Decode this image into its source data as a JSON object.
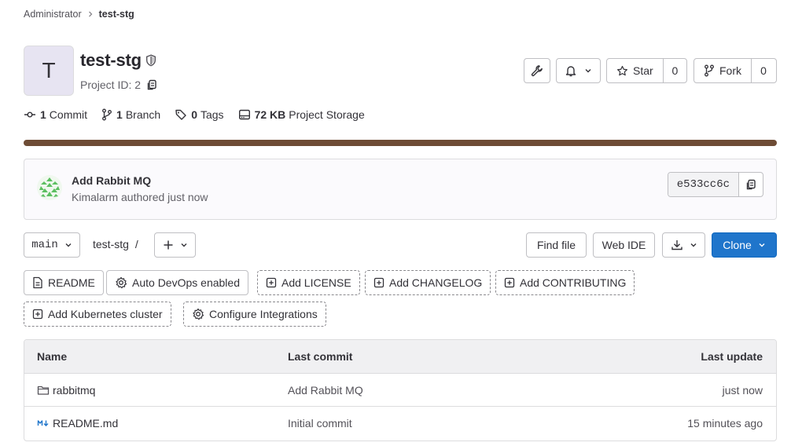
{
  "breadcrumb": {
    "parent": "Administrator",
    "current": "test-stg"
  },
  "project": {
    "avatar_letter": "T",
    "name": "test-stg",
    "id_label": "Project ID: 2",
    "visibility_icon": "shield-icon"
  },
  "header_actions": {
    "settings_icon": "wrench-icon",
    "notifications_icon": "bell-icon",
    "star_label": "Star",
    "star_count": "0",
    "fork_label": "Fork",
    "fork_count": "0"
  },
  "stats": {
    "commits_count": "1",
    "commits_label": "Commit",
    "branches_count": "1",
    "branches_label": "Branch",
    "tags_count": "0",
    "tags_label": "Tags",
    "storage_size": "72 KB",
    "storage_label": "Project Storage"
  },
  "language_bar_color": "#6e4c35",
  "last_commit": {
    "title": "Add Rabbit MQ",
    "author": "Kimalarm",
    "meta_suffix": "authored just now",
    "sha": "e533cc6c"
  },
  "toolbar": {
    "branch": "main",
    "path_root": "test-stg",
    "path_sep": "/",
    "find_file": "Find file",
    "web_ide": "Web IDE",
    "clone": "Clone"
  },
  "quick_actions": [
    {
      "label": "README",
      "icon": "file-icon",
      "style": "solid"
    },
    {
      "label": "Auto DevOps enabled",
      "icon": "settings-icon",
      "style": "solid"
    },
    {
      "label": "Add LICENSE",
      "icon": "plus-square-icon",
      "style": "dashed"
    },
    {
      "label": "Add CHANGELOG",
      "icon": "plus-square-icon",
      "style": "dashed"
    },
    {
      "label": "Add CONTRIBUTING",
      "icon": "plus-square-icon",
      "style": "dashed"
    },
    {
      "label": "Add Kubernetes cluster",
      "icon": "plus-square-icon",
      "style": "dashed"
    },
    {
      "label": "Configure Integrations",
      "icon": "settings-icon",
      "style": "dashed"
    }
  ],
  "files": {
    "columns": [
      "Name",
      "Last commit",
      "Last update"
    ],
    "rows": [
      {
        "name": "rabbitmq",
        "type": "folder",
        "last_commit": "Add Rabbit MQ",
        "last_update": "just now"
      },
      {
        "name": "README.md",
        "type": "markdown",
        "last_commit": "Initial commit",
        "last_update": "15 minutes ago"
      }
    ]
  },
  "colors": {
    "primary_button": "#1f75cb",
    "avatar_bg": "#e7e4f2",
    "table_header_bg": "#f0f0f2",
    "markdown_icon": "#1f75cb"
  }
}
